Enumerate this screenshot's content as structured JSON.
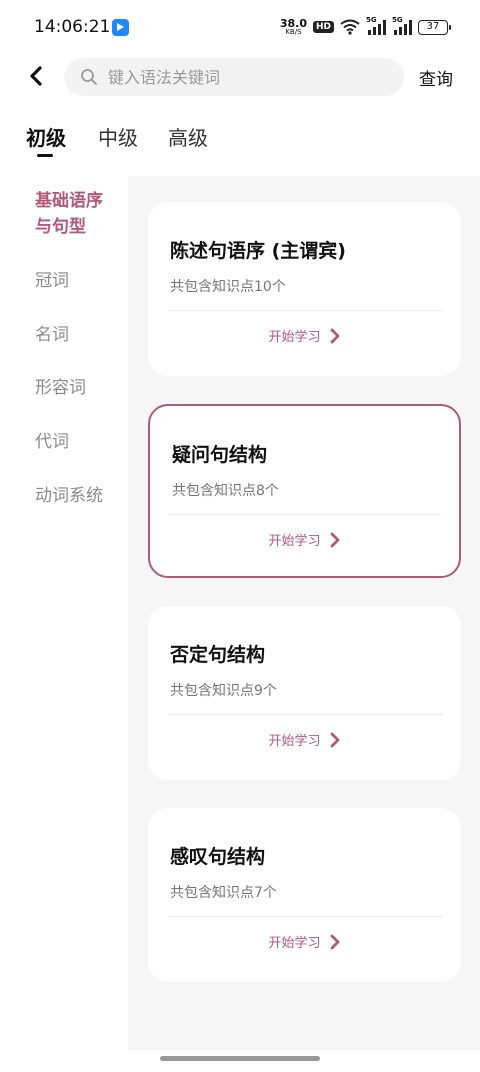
{
  "status": {
    "time": "14:06:21",
    "net_speed": "38.0",
    "net_unit": "KB/S",
    "hd": "HD",
    "sig1": "5G",
    "sig2": "5G",
    "battery": "37"
  },
  "search": {
    "placeholder": "键入语法关键词",
    "value": "",
    "query_label": "查询"
  },
  "levels": [
    {
      "label": "初级",
      "active": true
    },
    {
      "label": "中级",
      "active": false
    },
    {
      "label": "高级",
      "active": false
    }
  ],
  "sidebar": {
    "items": [
      {
        "label": "基础语序与句型",
        "active": true
      },
      {
        "label": "冠词"
      },
      {
        "label": "名词"
      },
      {
        "label": "形容词"
      },
      {
        "label": "代词"
      },
      {
        "label": "动词系统"
      }
    ]
  },
  "cards": [
    {
      "title": "陈述句语序 (主谓宾)",
      "count": "共包含知识点10个",
      "action": "开始学习"
    },
    {
      "title": "疑问句结构",
      "count": "共包含知识点8个",
      "action": "开始学习",
      "selected": true
    },
    {
      "title": "否定句结构",
      "count": "共包含知识点9个",
      "action": "开始学习"
    },
    {
      "title": "感叹句结构",
      "count": "共包含知识点7个",
      "action": "开始学习"
    }
  ],
  "colors": {
    "accent": "#b05a78",
    "content_bg": "#f6f6f6"
  }
}
